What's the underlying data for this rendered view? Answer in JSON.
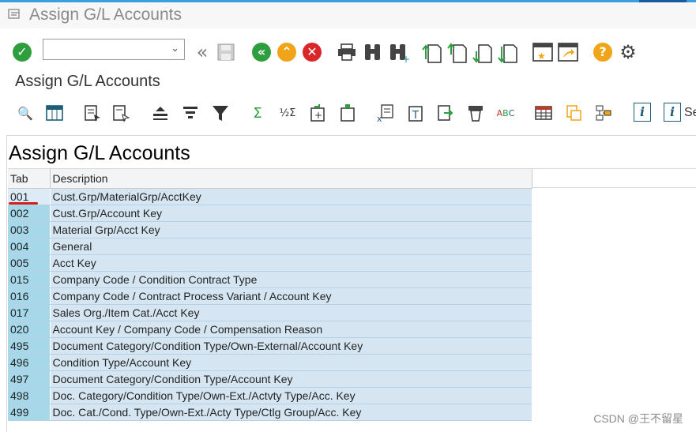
{
  "window": {
    "title": "Assign G/L Accounts"
  },
  "toolbar": {
    "command_field_value": "",
    "icons": [
      "enter-checkmark-icon",
      "back-icon",
      "save-icon",
      "green-back-icon",
      "exit-icon",
      "cancel-icon",
      "print-icon",
      "find-icon",
      "find-next-icon",
      "first-page-icon",
      "previous-page-icon",
      "next-page-icon",
      "last-page-icon",
      "create-session-icon",
      "shortcut-icon",
      "help-icon",
      "settings-icon"
    ]
  },
  "screen": {
    "subtitle": "Assign G/L Accounts"
  },
  "alv_toolbar": {
    "partial_label": "Se"
  },
  "panel": {
    "title": "Assign G/L Accounts"
  },
  "table": {
    "headers": {
      "tab": "Tab",
      "description": "Description"
    },
    "rows": [
      {
        "tab": "001",
        "description": "Cust.Grp/MaterialGrp/AcctKey"
      },
      {
        "tab": "002",
        "description": "Cust.Grp/Account Key"
      },
      {
        "tab": "003",
        "description": "Material Grp/Acct Key"
      },
      {
        "tab": "004",
        "description": "General"
      },
      {
        "tab": "005",
        "description": "Acct Key"
      },
      {
        "tab": "015",
        "description": "Company Code / Condition Contract Type"
      },
      {
        "tab": "016",
        "description": "Company Code / Contract Process Variant / Account Key"
      },
      {
        "tab": "017",
        "description": "Sales Org./Item Cat./Acct Key"
      },
      {
        "tab": "020",
        "description": "Account Key / Company Code / Compensation Reason"
      },
      {
        "tab": "495",
        "description": "Document Category/Condition Type/Own-External/Account Key"
      },
      {
        "tab": "496",
        "description": "Condition Type/Account Key"
      },
      {
        "tab": "497",
        "description": "Document Category/Condition Type/Account Key"
      },
      {
        "tab": "498",
        "description": "Doc. Category/Condition Type/Own-Ext./Actvty Type/Acc. Key"
      },
      {
        "tab": "499",
        "description": "Doc. Cat./Cond. Type/Own-Ext./Acty Type/Ctlg Group/Acc. Key"
      }
    ]
  },
  "watermark": "CSDN @王不留星",
  "colors": {
    "accent": "#3aa0dd",
    "key_cell": "#a6d8ea",
    "value_cell": "#d5e6f2",
    "selection_mark": "#d21f1f"
  }
}
